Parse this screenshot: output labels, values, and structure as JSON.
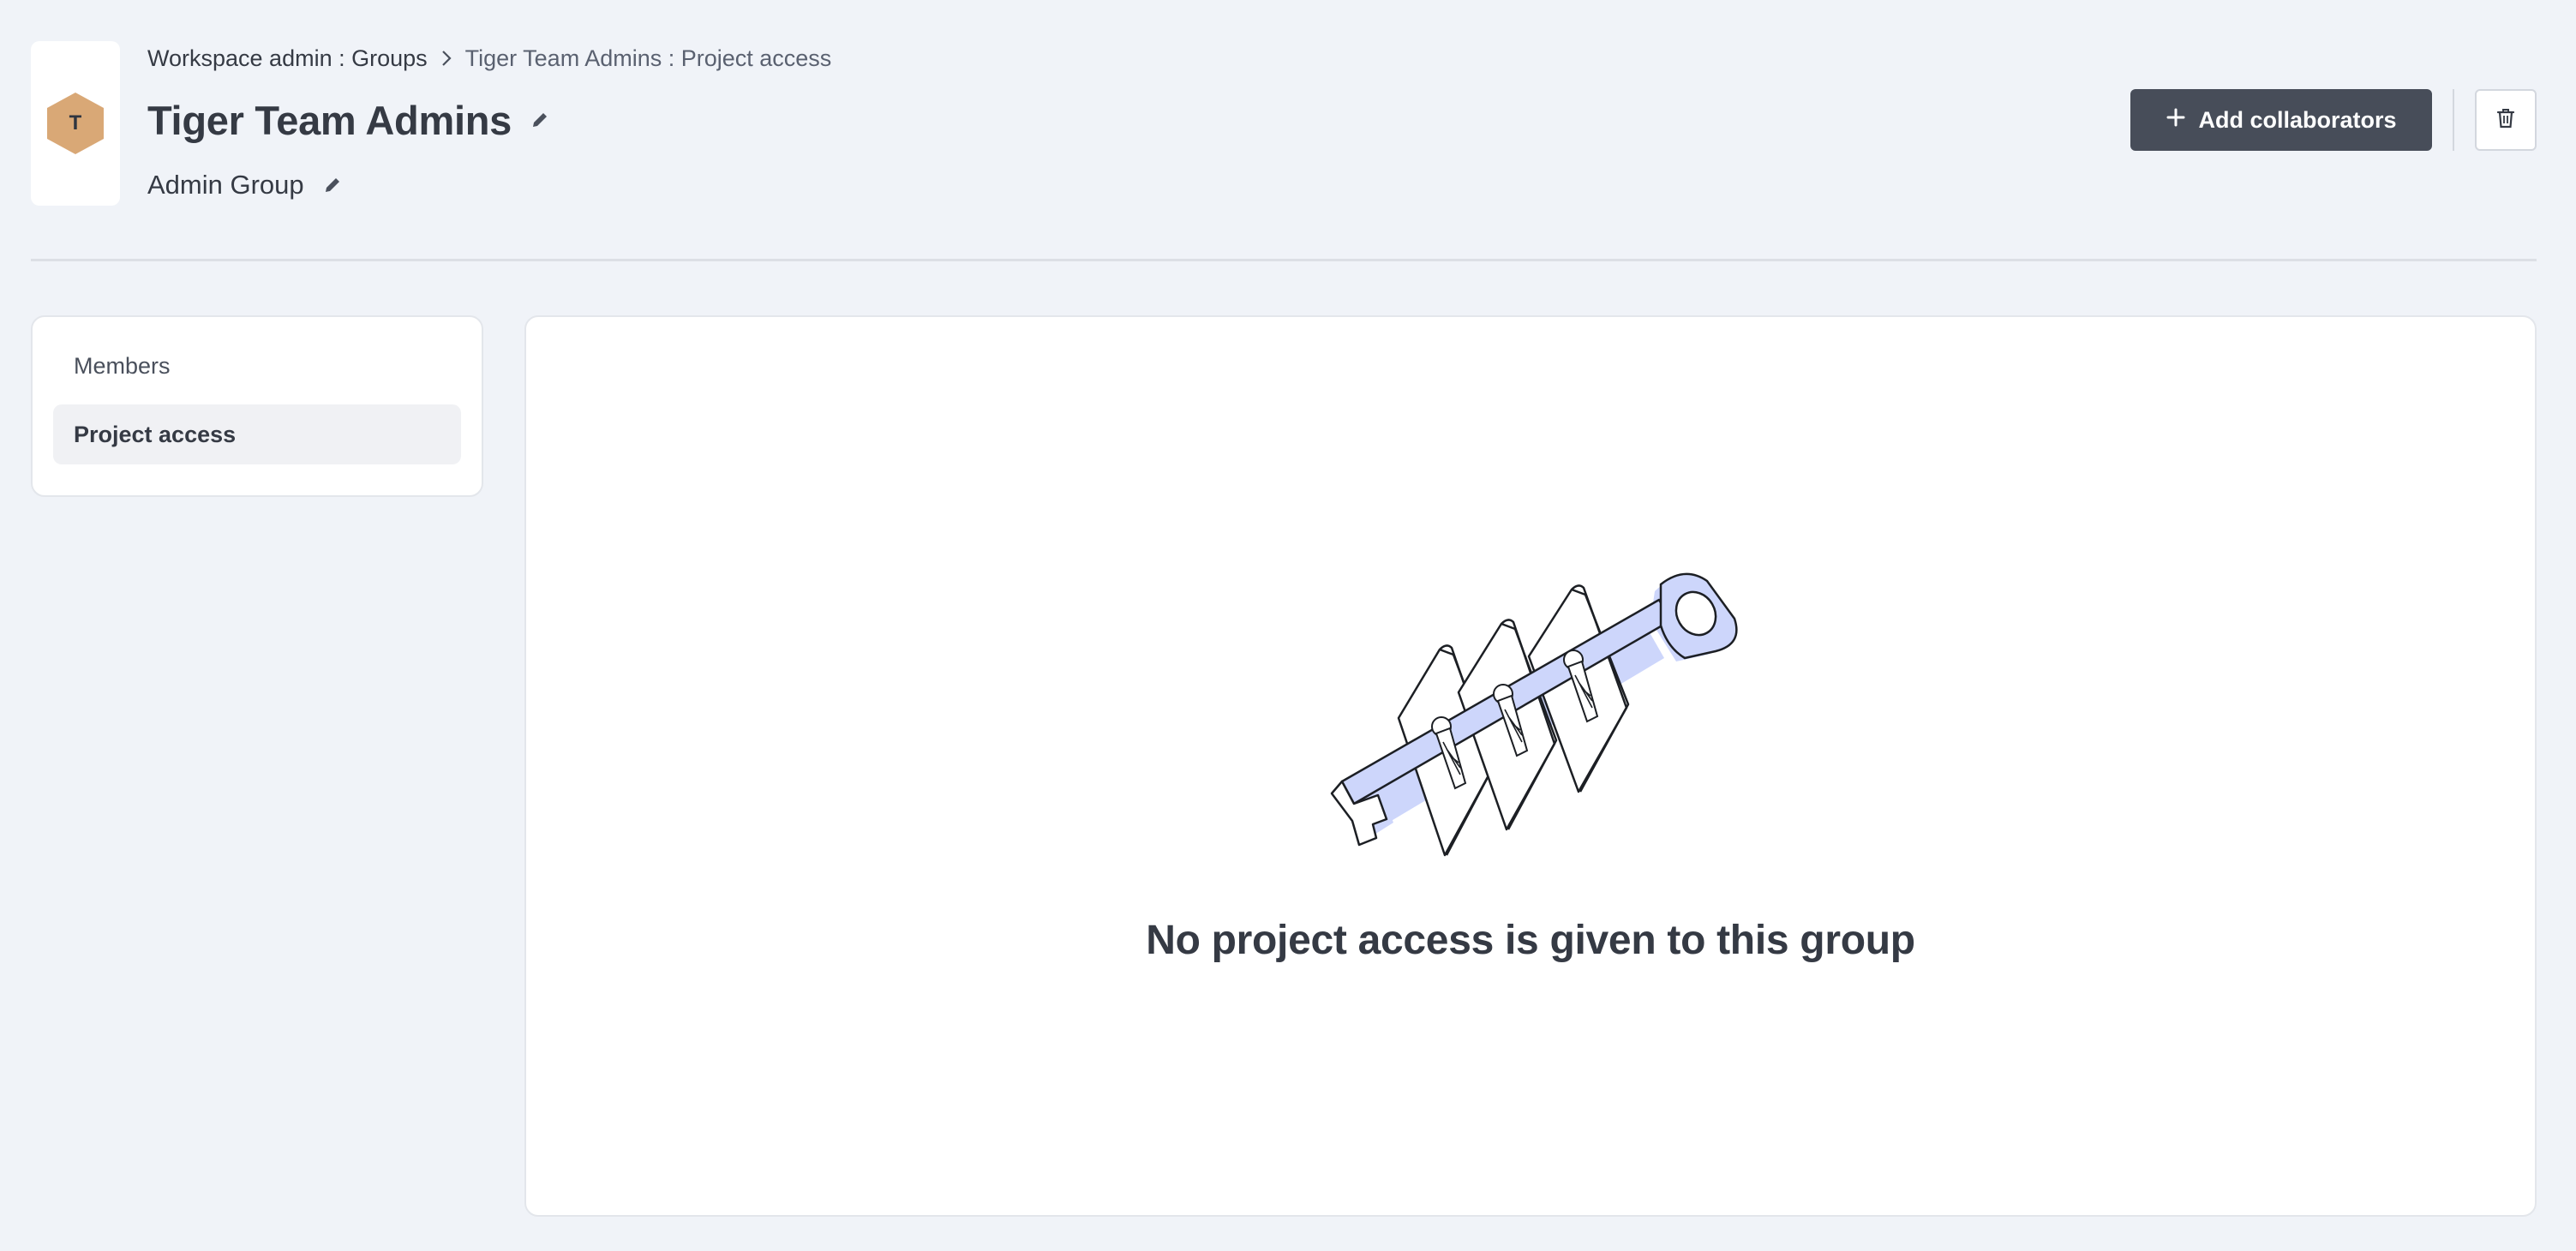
{
  "group": {
    "avatar_initial": "T",
    "avatar_color": "#d9a876",
    "name": "Tiger Team Admins",
    "description": "Admin Group"
  },
  "breadcrumb": [
    {
      "label": "Workspace admin : Groups"
    },
    {
      "label": "Tiger Team Admins : Project access"
    }
  ],
  "actions": {
    "add_label": "Add collaborators",
    "add_icon": "plus-icon",
    "delete_icon": "trash-icon"
  },
  "nav": {
    "items": [
      {
        "label": "Members",
        "active": false
      },
      {
        "label": "Project access",
        "active": true
      }
    ]
  },
  "empty_state": {
    "message": "No project access is given to this group",
    "illustration": "key-through-locks-icon"
  },
  "colors": {
    "primary_button": "#474d59",
    "background": "#f0f3f8",
    "accent": "#cdd6fb"
  }
}
